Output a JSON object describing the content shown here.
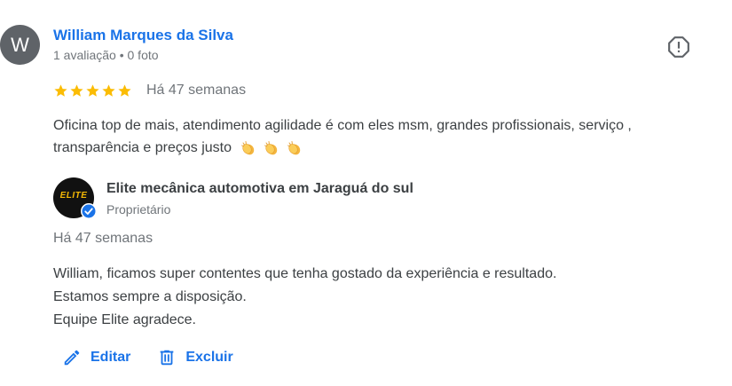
{
  "review": {
    "avatar_initial": "W",
    "reviewer_name": "William Marques da Silva",
    "reviewer_meta": "1 avaliação • 0 foto",
    "rating": 5,
    "time": "Há 47 semanas",
    "text": "Oficina top de mais, atendimento agilidade é com eles msm, grandes profissionais, serviço , transparência e preços justo",
    "emoji_count": 3
  },
  "owner_reply": {
    "logo_text": "ELITE",
    "name": "Elite mecânica automotiva em Jaraguá do sul",
    "role": "Proprietário",
    "time": "Há 47 semanas",
    "lines": [
      "William, ficamos super contentes que tenha gostado da experiência e resultado.",
      "Estamos sempre a disposição.",
      "Equipe Elite agradece."
    ]
  },
  "actions": {
    "edit_label": "Editar",
    "delete_label": "Excluir"
  },
  "icons": {
    "report": "report-flag-icon",
    "star": "star-icon",
    "edit": "pencil-icon",
    "delete": "trash-icon",
    "verified": "verified-check-icon",
    "emoji": "clapping-hands-icon"
  },
  "colors": {
    "link_blue": "#1a73e8",
    "star_gold": "#fbbc04",
    "text": "#3c4043",
    "secondary": "#70757a",
    "avatar_bg": "#5f6368"
  }
}
